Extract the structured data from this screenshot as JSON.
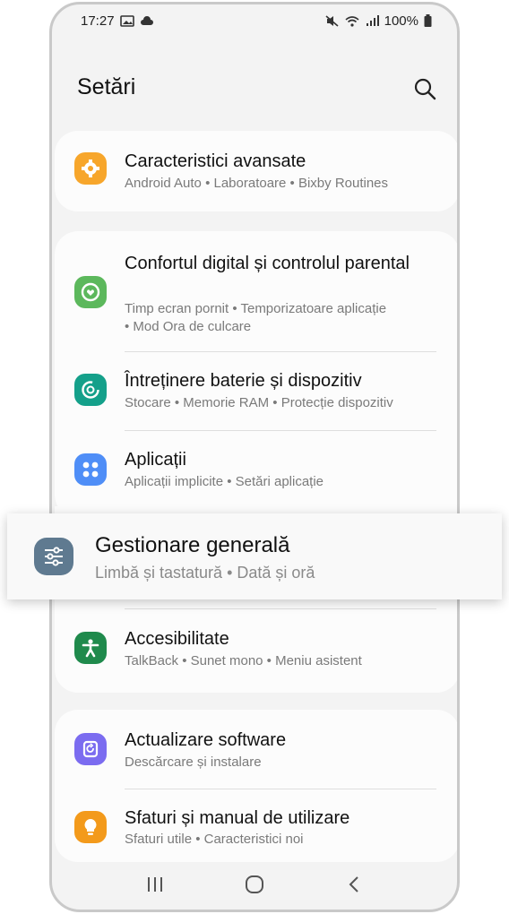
{
  "status": {
    "time": "17:27",
    "battery": "100%"
  },
  "header": {
    "title": "Setări"
  },
  "colors": {
    "orange": "#f7a62b",
    "green": "#5cb85c",
    "teal": "#14a08a",
    "blue": "#4f8ef7",
    "slate": "#5f7a90",
    "accessibility_green": "#1f8a4c",
    "purple": "#7b6cf0",
    "yellow": "#f39a1b"
  },
  "items": {
    "advanced": {
      "title": "Caracteristici avansate",
      "sub": "Android Auto  •  Laboratoare  •  Bixby Routines",
      "icon": "gear-puzzle-icon"
    },
    "digital": {
      "title": "Confortul digital și controlul parental",
      "sub1": "Timp ecran pornit  •  Temporizatoare aplicație",
      "sub2": "•  Mod Ora de culcare",
      "icon": "wellbeing-icon"
    },
    "battery": {
      "title": "Întreținere baterie și dispozitiv",
      "sub": "Stocare  •  Memorie RAM  •  Protecție dispozitiv",
      "icon": "device-care-icon"
    },
    "apps": {
      "title": "Aplicații",
      "sub": "Aplicații implicite  •  Setări aplicație",
      "icon": "apps-grid-icon"
    },
    "general": {
      "title": "Gestionare generală",
      "sub": "Limbă și tastatură  •  Dată și oră",
      "icon": "sliders-icon"
    },
    "accessibility": {
      "title": "Accesibilitate",
      "sub": "TalkBack  •  Sunet mono  •  Meniu asistent",
      "icon": "accessibility-icon"
    },
    "update": {
      "title": "Actualizare software",
      "sub": "Descărcare și instalare",
      "icon": "software-update-icon"
    },
    "tips": {
      "title": "Sfaturi și manual de utilizare",
      "sub": "Sfaturi utile  •  Caracteristici noi",
      "icon": "lightbulb-icon"
    }
  },
  "navbar": {
    "recent": "recent-apps-icon",
    "home": "home-icon",
    "back": "back-icon"
  }
}
